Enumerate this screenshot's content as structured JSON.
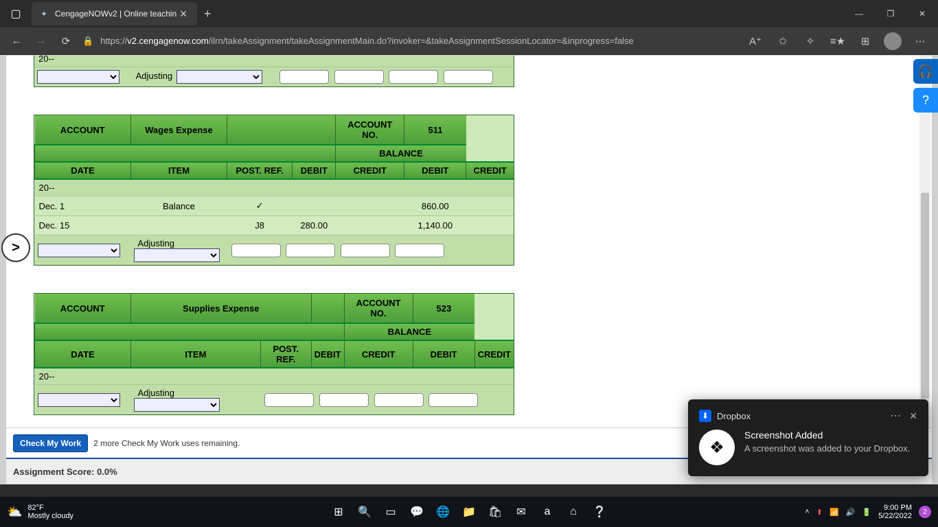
{
  "browser": {
    "tab_title": "CengageNOWv2 | Online teachin",
    "url_prefix": "https://",
    "url_domain": "v2.cengagenow.com",
    "url_path": "/ilrn/takeAssignment/takeAssignmentMain.do?invoker=&takeAssignmentSessionLocator=&inprogress=false"
  },
  "labels": {
    "account": "ACCOUNT",
    "account_no": "ACCOUNT NO.",
    "balance": "BALANCE",
    "date": "DATE",
    "item": "ITEM",
    "postref": "POST. REF.",
    "debit": "DEBIT",
    "credit": "CREDIT",
    "year": "20--",
    "adjusting": "Adjusting"
  },
  "ledgers": [
    {
      "account_name": "",
      "account_no": "",
      "rows": [],
      "partial": true
    },
    {
      "account_name": "Wages Expense",
      "account_no": "511",
      "rows": [
        {
          "date": "Dec. 1",
          "item": "Balance",
          "postref": "✓",
          "debit": "",
          "credit": "",
          "bal_debit": "860.00",
          "bal_credit": ""
        },
        {
          "date": "Dec. 15",
          "item": "",
          "postref": "J8",
          "debit": "280.00",
          "credit": "",
          "bal_debit": "1,140.00",
          "bal_credit": ""
        }
      ]
    },
    {
      "account_name": "Supplies Expense",
      "account_no": "523",
      "rows": []
    }
  ],
  "footer": {
    "check_btn": "Check My Work",
    "remaining": "2 more Check My Work uses remaining.",
    "score_label": "Assignment Score: 0.0%"
  },
  "toast": {
    "app": "Dropbox",
    "title": "Screenshot Added",
    "msg": "A screenshot was added to your Dropbox."
  },
  "taskbar": {
    "temp": "82°F",
    "cond": "Mostly cloudy",
    "time": "9:00 PM",
    "date": "5/22/2022",
    "notif": "2"
  }
}
